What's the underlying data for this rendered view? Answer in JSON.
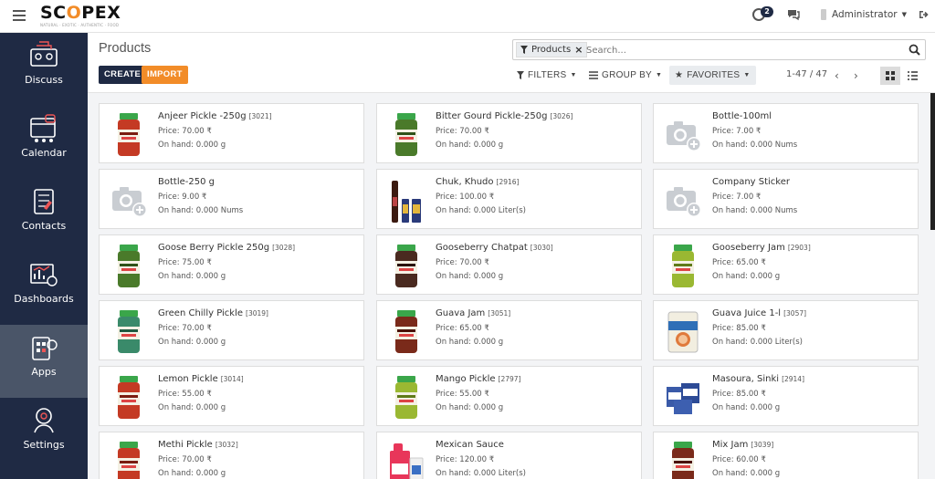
{
  "brand": {
    "logo_pre": "SC",
    "logo_o": "O",
    "logo_post": "PEX",
    "tagline": "NATURAL · EXOTIC · AUTHENTIC · FOOD"
  },
  "topbar": {
    "activity_count": "2",
    "user_name": "Administrator"
  },
  "sidebar": {
    "items": [
      {
        "label": "Discuss",
        "icon": "discuss-icon"
      },
      {
        "label": "Calendar",
        "icon": "calendar-icon"
      },
      {
        "label": "Contacts",
        "icon": "contacts-icon"
      },
      {
        "label": "Dashboards",
        "icon": "dashboards-icon"
      },
      {
        "label": "Apps",
        "icon": "apps-icon",
        "active": true
      },
      {
        "label": "Settings",
        "icon": "settings-icon"
      }
    ]
  },
  "control_panel": {
    "title": "Products",
    "create_label": "CREATE",
    "import_label": "IMPORT",
    "facet_label": "Products",
    "search_placeholder": "Search...",
    "filters_label": "FILTERS",
    "groupby_label": "GROUP BY",
    "favorites_label": "FAVORITES",
    "pager_text": "1-47 / 47"
  },
  "products": [
    {
      "name": "Anjeer Pickle -250g",
      "code": "[3021]",
      "price": "Price: 70.00 ₹",
      "onhand": "On hand: 0.000 g",
      "img": "jar-red"
    },
    {
      "name": "Bitter Gourd Pickle-250g",
      "code": "[3026]",
      "price": "Price: 70.00 ₹",
      "onhand": "On hand: 0.000 g",
      "img": "jar-green"
    },
    {
      "name": "Bottle-100ml",
      "code": "",
      "price": "Price: 7.00 ₹",
      "onhand": "On hand: 0.000 Nums",
      "img": "placeholder"
    },
    {
      "name": "Bottle-250 g",
      "code": "",
      "price": "Price: 9.00 ₹",
      "onhand": "On hand: 0.000 Nums",
      "img": "placeholder"
    },
    {
      "name": "Chuk, Khudo",
      "code": "[2916]",
      "price": "Price: 100.00 ₹",
      "onhand": "On hand: 0.000 Liter(s)",
      "img": "bottles"
    },
    {
      "name": "Company Sticker",
      "code": "",
      "price": "Price: 7.00 ₹",
      "onhand": "On hand: 0.000 Nums",
      "img": "placeholder"
    },
    {
      "name": "Goose Berry Pickle 250g",
      "code": "[3028]",
      "price": "Price: 75.00 ₹",
      "onhand": "On hand: 0.000 g",
      "img": "jar-green"
    },
    {
      "name": "Gooseberry Chatpat",
      "code": "[3030]",
      "price": "Price: 70.00 ₹",
      "onhand": "On hand: 0.000 g",
      "img": "jar-dark"
    },
    {
      "name": "Gooseberry Jam",
      "code": "[2903]",
      "price": "Price: 65.00 ₹",
      "onhand": "On hand: 0.000 g",
      "img": "jar-lime"
    },
    {
      "name": "Green Chilly Pickle",
      "code": "[3019]",
      "price": "Price: 70.00 ₹",
      "onhand": "On hand: 0.000 g",
      "img": "jar-teal"
    },
    {
      "name": "Guava Jam",
      "code": "[3051]",
      "price": "Price: 65.00 ₹",
      "onhand": "On hand: 0.000 g",
      "img": "jar-brown"
    },
    {
      "name": "Guava Juice 1-l",
      "code": "[3057]",
      "price": "Price: 85.00 ₹",
      "onhand": "On hand: 0.000 Liter(s)",
      "img": "can"
    },
    {
      "name": "Lemon Pickle",
      "code": "[3014]",
      "price": "Price: 55.00 ₹",
      "onhand": "On hand: 0.000 g",
      "img": "jar-red"
    },
    {
      "name": "Mango Pickle",
      "code": "[2797]",
      "price": "Price: 55.00 ₹",
      "onhand": "On hand: 0.000 g",
      "img": "jar-lime"
    },
    {
      "name": "Masoura, Sinki",
      "code": "[2914]",
      "price": "Price: 85.00 ₹",
      "onhand": "On hand: 0.000 g",
      "img": "packets"
    },
    {
      "name": "Methi Pickle",
      "code": "[3032]",
      "price": "Price: 70.00 ₹",
      "onhand": "On hand: 0.000 g",
      "img": "jar-red"
    },
    {
      "name": "Mexican Sauce",
      "code": "",
      "price": "Price: 120.00 ₹",
      "onhand": "On hand: 0.000 Liter(s)",
      "img": "jerrycan"
    },
    {
      "name": "Mix Jam",
      "code": "[3039]",
      "price": "Price: 60.00 ₹",
      "onhand": "On hand: 0.000 g",
      "img": "jar-brown"
    }
  ]
}
